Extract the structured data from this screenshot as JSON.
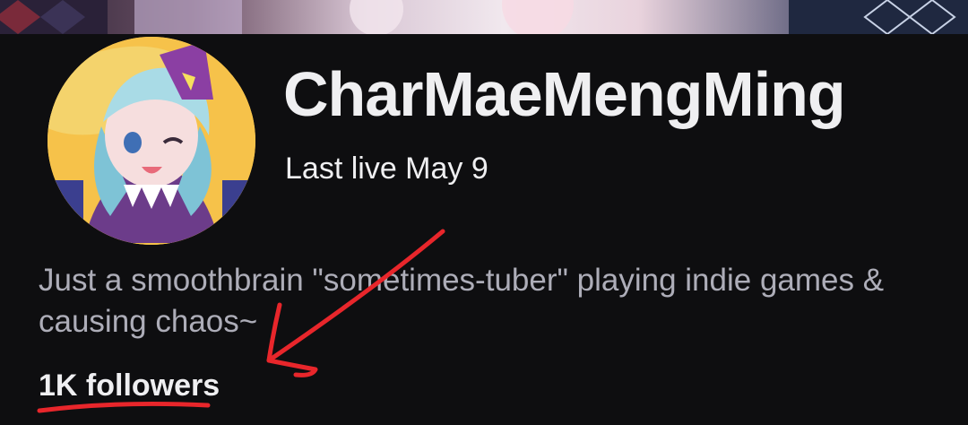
{
  "profile": {
    "channel_name": "CharMaeMengMing",
    "last_live": "Last live May 9",
    "bio": "Just a smoothbrain \"sometimes-tuber\" playing indie games & causing chaos~",
    "followers": "1K followers"
  },
  "annotation": {
    "color": "#e8262b"
  }
}
